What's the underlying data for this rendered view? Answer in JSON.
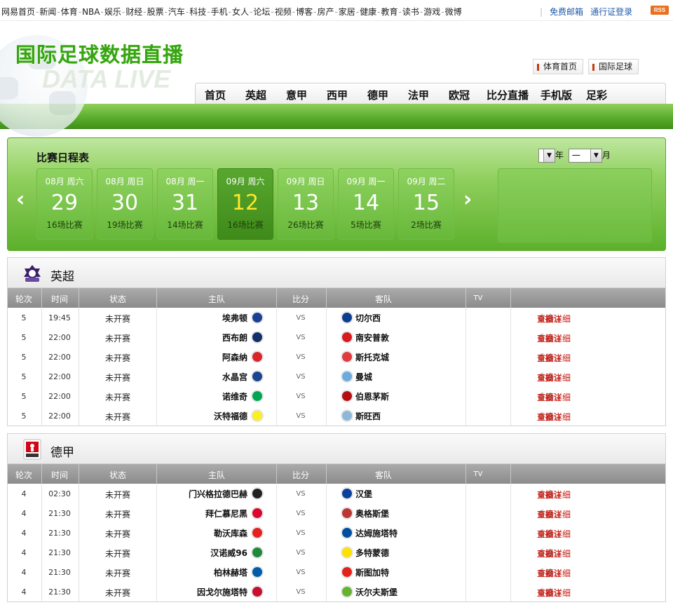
{
  "topnav": {
    "links": [
      "网易首页",
      "新闻",
      "体育",
      "NBA",
      "娱乐",
      "财经",
      "股票",
      "汽车",
      "科技",
      "手机",
      "女人",
      "论坛",
      "视频",
      "博客",
      "房产",
      "家居",
      "健康",
      "教育",
      "读书",
      "游戏",
      "微博"
    ],
    "mail": "免费邮箱",
    "login": "通行证登录",
    "rss": "RSS"
  },
  "header": {
    "title": "国际足球数据直播",
    "subtitle": "DATA LIVE",
    "quick_links": [
      "体育首页",
      "国际足球"
    ],
    "nav": [
      "首页",
      "英超",
      "意甲",
      "西甲",
      "德甲",
      "法甲",
      "欧冠",
      "比分直播",
      "手机版",
      "足彩"
    ]
  },
  "schedule": {
    "title": "比赛日程表",
    "prev": "‹",
    "next": "›",
    "year_value": "",
    "year_label": "年",
    "month_value": "一",
    "month_label": "月",
    "days": [
      {
        "header": "08月 周六",
        "day": "29",
        "count": "16场比赛",
        "selected": false
      },
      {
        "header": "08月 周日",
        "day": "30",
        "count": "19场比赛",
        "selected": false
      },
      {
        "header": "08月 周一",
        "day": "31",
        "count": "14场比赛",
        "selected": false
      },
      {
        "header": "09月 周六",
        "day": "12",
        "count": "16场比赛",
        "selected": true
      },
      {
        "header": "09月 周日",
        "day": "13",
        "count": "26场比赛",
        "selected": false
      },
      {
        "header": "09月 周一",
        "day": "14",
        "count": "5场比赛",
        "selected": false
      },
      {
        "header": "09月 周二",
        "day": "15",
        "count": "2场比赛",
        "selected": false
      }
    ]
  },
  "columns": {
    "round": "轮次",
    "time": "时间",
    "status": "状态",
    "home": "主队",
    "score": "比分",
    "away": "客队",
    "tv": "TV"
  },
  "actions": {
    "live": "直播",
    "detail": "查看详细",
    "chevron": "»",
    "bet": "投注"
  },
  "leagues": [
    {
      "name": "英超",
      "logo": "premier-league-logo",
      "matches": [
        {
          "round": "5",
          "time": "19:45",
          "status": "未开赛",
          "home": "埃弗顿",
          "score": "VS",
          "away": "切尔西",
          "home_color": "#1b3f93",
          "away_color": "#0b3d91"
        },
        {
          "round": "5",
          "time": "22:00",
          "status": "未开赛",
          "home": "西布朗",
          "score": "VS",
          "away": "南安普敦",
          "home_color": "#122f67",
          "away_color": "#d71920"
        },
        {
          "round": "5",
          "time": "22:00",
          "status": "未开赛",
          "home": "阿森纳",
          "score": "VS",
          "away": "斯托克城",
          "home_color": "#d8262c",
          "away_color": "#e03a3e"
        },
        {
          "round": "5",
          "time": "22:00",
          "status": "未开赛",
          "home": "水晶宫",
          "score": "VS",
          "away": "曼城",
          "home_color": "#1b458f",
          "away_color": "#6cabdd"
        },
        {
          "round": "5",
          "time": "22:00",
          "status": "未开赛",
          "home": "诺维奇",
          "score": "VS",
          "away": "伯恩茅斯",
          "home_color": "#00a650",
          "away_color": "#b50e12"
        },
        {
          "round": "5",
          "time": "22:00",
          "status": "未开赛",
          "home": "沃特福德",
          "score": "VS",
          "away": "斯旺西",
          "home_color": "#fbee23",
          "away_color": "#8fb7d6"
        }
      ]
    },
    {
      "name": "德甲",
      "logo": "bundesliga-logo",
      "matches": [
        {
          "round": "4",
          "time": "02:30",
          "status": "未开赛",
          "home": "门兴格拉德巴赫",
          "score": "VS",
          "away": "汉堡",
          "home_color": "#222222",
          "away_color": "#0a3f9c"
        },
        {
          "round": "4",
          "time": "21:30",
          "status": "未开赛",
          "home": "拜仁慕尼黑",
          "score": "VS",
          "away": "奥格斯堡",
          "home_color": "#dc052d",
          "away_color": "#ba3733"
        },
        {
          "round": "4",
          "time": "21:30",
          "status": "未开赛",
          "home": "勒沃库森",
          "score": "VS",
          "away": "达姆施塔特",
          "home_color": "#e32221",
          "away_color": "#004e9f"
        },
        {
          "round": "4",
          "time": "21:30",
          "status": "未开赛",
          "home": "汉诺威96",
          "score": "VS",
          "away": "多特蒙德",
          "home_color": "#1f8a3a",
          "away_color": "#fde100"
        },
        {
          "round": "4",
          "time": "21:30",
          "status": "未开赛",
          "home": "柏林赫塔",
          "score": "VS",
          "away": "斯图加特",
          "home_color": "#005ca9",
          "away_color": "#e32219"
        },
        {
          "round": "4",
          "time": "21:30",
          "status": "未开赛",
          "home": "因戈尔施塔特",
          "score": "VS",
          "away": "沃尔夫斯堡",
          "home_color": "#c8102e",
          "away_color": "#65b32e"
        }
      ]
    }
  ]
}
